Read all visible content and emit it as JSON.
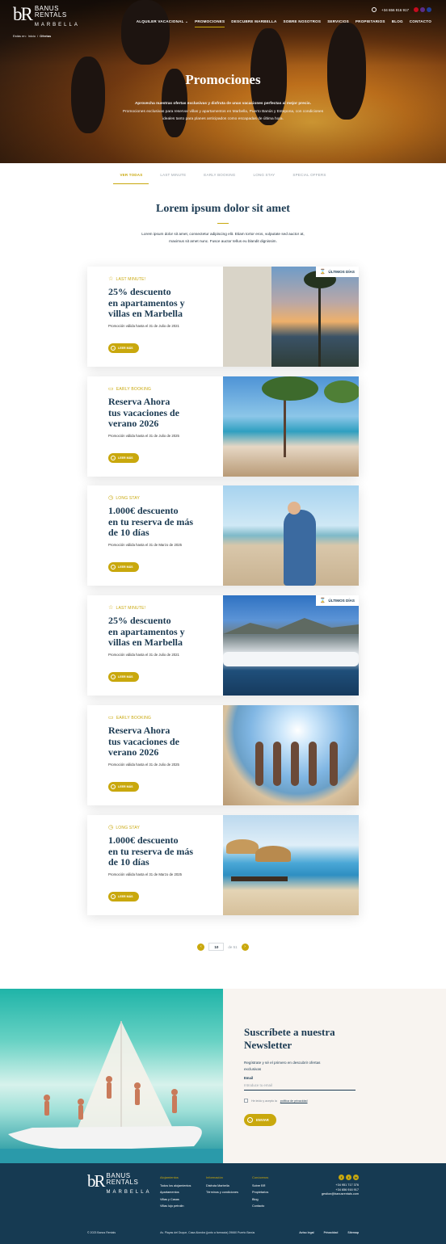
{
  "brand": {
    "logo_mark": "bR",
    "name_line1": "BANUS",
    "name_line2": "RENTALS",
    "name_line3": "MARBELLA"
  },
  "breadcrumb": {
    "here": "Estás en:",
    "home": "Inicio",
    "sep": "/",
    "current": "Ofertas"
  },
  "topbar": {
    "phone": "+34 656 916 917",
    "flags": [
      "#c60b1e",
      "#5b2d8a",
      "#1f3f99"
    ]
  },
  "nav": {
    "items": [
      {
        "label": "ALQUILER VACACIONAL",
        "has_chevron": true
      },
      {
        "label": "PROMOCIONES",
        "active": true
      },
      {
        "label": "DESCUBRE MARBELLA"
      },
      {
        "label": "SOBRE NOSOTROS"
      },
      {
        "label": "SERVICIOS"
      },
      {
        "label": "PROPIETARIOS"
      },
      {
        "label": "BLOG"
      },
      {
        "label": "CONTACTO"
      }
    ]
  },
  "hero": {
    "title": "Promociones",
    "sub_bold": "Aprovecha nuestras ofertas exclusivas y disfruta de unas vacaciones perfectas al mejor precio.",
    "sub_text": "Promociones exclusivas para reservar villas y apartamentos en Marbella, Puerto Banús y Estepona, con condiciones ideales tanto para planes anticipados como escapadas de última hora."
  },
  "tabs": [
    {
      "label": "VER TODAS",
      "active": true
    },
    {
      "label": "LAST MINUTE"
    },
    {
      "label": "EARLY BOOKING"
    },
    {
      "label": "LONG STAY"
    },
    {
      "label": "SPECIAL OFFERS"
    }
  ],
  "intro": {
    "title": "Lorem ipsum dolor sit amet",
    "text": "Lorem ipsum dolor sit amet, consectetur adipiscing elit. Etiam tortor eros, vulputate sed auctor at, maximus  sit amet nunc. Fusce auctor tellus eu blandit dignissim."
  },
  "offers": [
    {
      "category": "LAST MINUTE!",
      "icon": "star-icon",
      "title_bold": "25% descuento",
      "title_rest": "en apartamentos y villas en Marbella",
      "valid": "Promoción válida hasta el 31 de Julio de 2021",
      "button": "LEER MÁS",
      "badge": "ÚLTIMOS DÍAS",
      "image": "sunset-palms-photo"
    },
    {
      "category": "EARLY BOOKING",
      "icon": "calendar-icon",
      "title_bold": "Reserva Ahora",
      "title_rest": "tus vacaciones de verano 2026",
      "valid": "Promoción válida hasta el 31 de Julio de 2025",
      "button": "LEER MÁS",
      "badge": "",
      "image": "terrace-sea-photo"
    },
    {
      "category": "LONG STAY",
      "icon": "clock-icon",
      "title_bold": "1.000€ descuento",
      "title_rest": "en tu reserva de más de 10 días",
      "valid": "Promoción válida hasta el 31 de Marzo de 2025",
      "button": "LEER MÁS",
      "badge": "",
      "image": "couple-beach-photo"
    },
    {
      "category": "LAST MINUTE!",
      "icon": "star-icon",
      "title_bold": "25% descuento",
      "title_rest": "en apartamentos y villas en Marbella",
      "valid": "Promoción válida hasta el 31 de Julio de 2021",
      "button": "LEER MÁS",
      "badge": "ÚLTIMOS DÍAS",
      "image": "marina-port-photo"
    },
    {
      "category": "EARLY BOOKING",
      "icon": "calendar-icon",
      "title_bold": "Reserva Ahora",
      "title_rest": "tus vacaciones de verano 2026",
      "valid": "Promoción válida hasta el 31 de Julio de 2025",
      "button": "LEER MÁS",
      "badge": "",
      "image": "friends-running-photo"
    },
    {
      "category": "LONG STAY",
      "icon": "clock-icon",
      "title_bold": "1.000€ descuento",
      "title_rest": "en tu reserva de más de 10 días",
      "valid": "Promoción válida hasta el 31 de Marzo de 2025",
      "button": "LEER MÁS",
      "badge": "",
      "image": "beach-umbrellas-photo"
    }
  ],
  "pagination": {
    "prev": "‹",
    "current": "10",
    "of": "de 51",
    "next": "›"
  },
  "newsletter": {
    "title": "Suscríbete a nuestra Newsletter",
    "text": "Regístrate y sé el primero en descubrir ofertas exclusivas",
    "email_label": "Email",
    "email_placeholder": "Introduce tu email",
    "email_value": "",
    "consent_pre": "He leído y acepto la",
    "consent_link": "política de privacidad",
    "submit": "ENVIAR"
  },
  "footer": {
    "columns": [
      {
        "heading": "Alojamientos",
        "items": [
          "Todos los alojamientos",
          "Apartamentos",
          "Villas y Casas",
          "Villas lujo petrolin"
        ]
      },
      {
        "heading": "Información",
        "items": [
          "Disfruta Marbella",
          "Términos y condiciones"
        ]
      },
      {
        "heading": "Conócenos",
        "items": [
          "Sobre BR",
          "Propietarios",
          "Blog",
          "Contacto"
        ]
      }
    ],
    "social": [
      "f",
      "t",
      "in"
    ],
    "phone1": "+34 951 717 376",
    "phone2": "+34 656 916 917",
    "email": "gestion@banusrentals.com",
    "copyright": "© 2023 Banus Rentals",
    "address": "Av. Playas del Duque, Casa Alondra (junto a farmacia) 29660 Puerto Banús",
    "legal_links": [
      "Aviso legal",
      "Privacidad",
      "Sitemap"
    ]
  },
  "colors": {
    "accent": "#c9a80d",
    "navy": "#163a52",
    "title": "#1b3a52",
    "cream": "#f8f4f0"
  }
}
